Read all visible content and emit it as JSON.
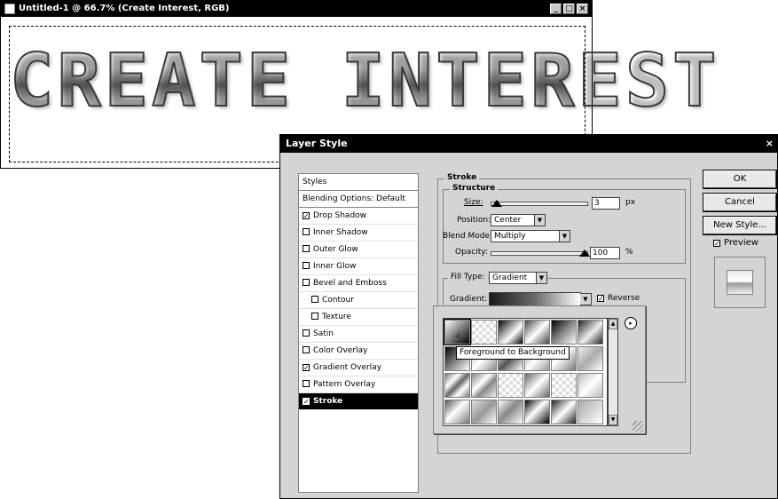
{
  "document_window": {
    "title": "Untitled-1 @ 66.7% (Create Interest, RGB)",
    "controls": [
      "_",
      "□",
      "×"
    ],
    "canvas_text": "CREATE INTEREST"
  },
  "dialog": {
    "title": "Layer Style",
    "close_glyph": "×",
    "styles_list": {
      "header": "Styles",
      "blending": "Blending Options: Default",
      "items": [
        {
          "label": "Drop Shadow",
          "checked": true
        },
        {
          "label": "Inner Shadow",
          "checked": false
        },
        {
          "label": "Outer Glow",
          "checked": false
        },
        {
          "label": "Inner Glow",
          "checked": false
        },
        {
          "label": "Bevel and Emboss",
          "checked": false
        },
        {
          "label": "Contour",
          "checked": false
        },
        {
          "label": "Texture",
          "checked": false
        },
        {
          "label": "Satin",
          "checked": false
        },
        {
          "label": "Color Overlay",
          "checked": false
        },
        {
          "label": "Gradient Overlay",
          "checked": true
        },
        {
          "label": "Pattern Overlay",
          "checked": false
        },
        {
          "label": "Stroke",
          "checked": true
        }
      ]
    },
    "stroke": {
      "legend": "Stroke",
      "structure_legend": "Structure",
      "size_label": "Size:",
      "size_value": "3",
      "size_unit": "px",
      "position_label": "Position:",
      "position_value": "Center",
      "blend_label": "Blend Mode:",
      "blend_value": "Multiply",
      "opacity_label": "Opacity:",
      "opacity_value": "100",
      "opacity_unit": "%",
      "fill_type_label": "Fill Type:",
      "fill_type_value": "Gradient",
      "gradient_label": "Gradient:",
      "reverse_label": "Reverse",
      "reverse_checked": true
    },
    "picker": {
      "tooltip": "Foreground to Background",
      "menu_glyph": "▸"
    },
    "buttons": {
      "ok": "OK",
      "cancel": "Cancel",
      "new_style": "New Style...",
      "preview_label": "Preview",
      "preview_checked": true
    }
  }
}
